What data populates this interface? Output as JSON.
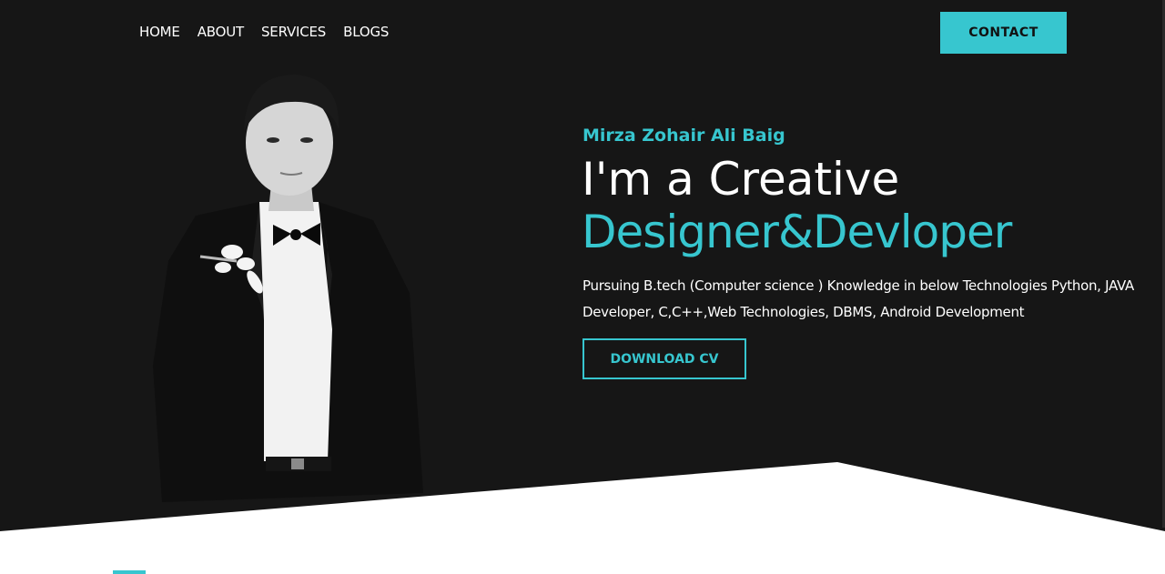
{
  "nav": {
    "items": [
      {
        "label": "HOME"
      },
      {
        "label": "ABOUT"
      },
      {
        "label": "SERVICES"
      },
      {
        "label": "BLOGS"
      }
    ],
    "contact_label": "CONTACT"
  },
  "hero": {
    "name": "Mirza Zohair Ali Baig",
    "headline_1": "I'm a Creative",
    "headline_2": "Designer&Devloper",
    "description": "Pursuing B.tech (Computer science ) Knowledge in below Technologies Python, JAVA Developer, C,C++,Web Technologies, DBMS, Android Development",
    "cv_button": "DOWNLOAD CV"
  },
  "colors": {
    "background": "#161616",
    "accent": "#37c6cf",
    "text": "#ffffff"
  },
  "icons": {
    "portrait": "profile-photo"
  }
}
